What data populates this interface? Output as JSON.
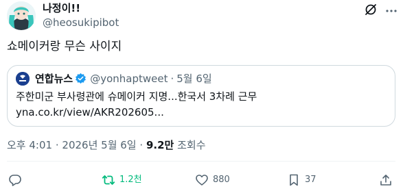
{
  "author": {
    "display_name": "나정이!!",
    "handle": "@heosukipibot"
  },
  "tweet_text": "쇼메이커랑 무슨 사이지",
  "quote": {
    "display_name": "연합뉴스",
    "handle": "@yonhaptweet",
    "dot": "·",
    "date": "5월 6일",
    "line1": "주한미군 부사령관에 슈메이커 지명...한국서 3차례 근무",
    "line2": "yna.co.kr/view/AKR202605..."
  },
  "meta": {
    "time": "오후 4:01",
    "sep1": "·",
    "date": "2026년 5월 6일",
    "sep2": "·",
    "views_count": "9.2만",
    "views_label": "조회수"
  },
  "actions": {
    "reply_count": "",
    "retweet_count": "1.2천",
    "like_count": "880",
    "bookmark_count": "37"
  },
  "icons": {
    "grok": "grok-icon",
    "more": "more-icon",
    "verified": "verified-badge-icon",
    "reply": "reply-icon",
    "retweet": "retweet-icon",
    "like": "heart-icon",
    "bookmark": "bookmark-icon",
    "share": "share-icon"
  },
  "colors": {
    "text": "#0f1419",
    "secondary": "#536471",
    "retweet_active": "#00ba7c",
    "verified": "#1d9bf0",
    "border": "#cfd9de"
  }
}
